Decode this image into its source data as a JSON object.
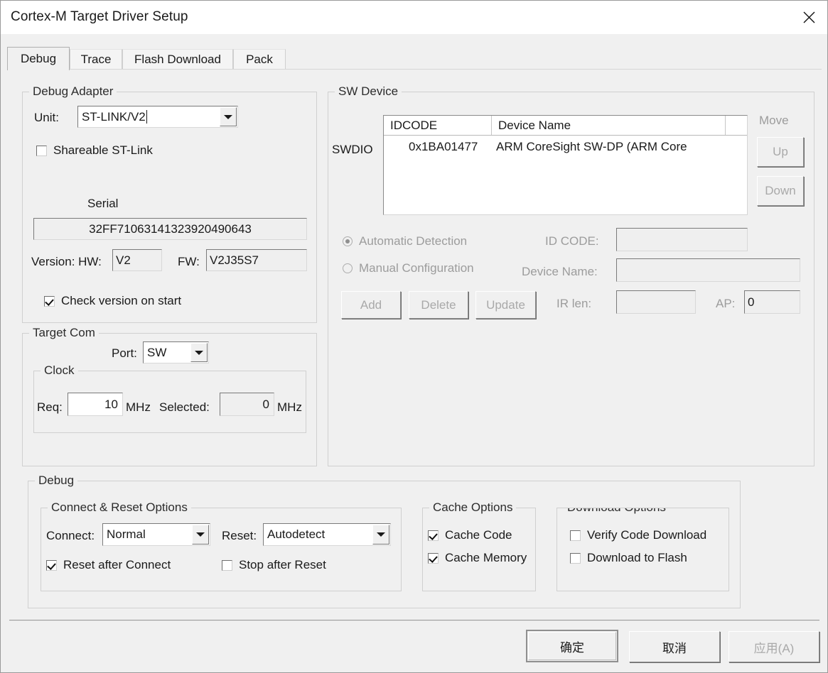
{
  "window": {
    "title": "Cortex-M Target Driver Setup",
    "close_icon": "close-icon"
  },
  "tabs": [
    {
      "label": "Debug",
      "active": true
    },
    {
      "label": "Trace",
      "active": false
    },
    {
      "label": "Flash Download",
      "active": false
    },
    {
      "label": "Pack",
      "active": false
    }
  ],
  "debug_adapter": {
    "legend": "Debug Adapter",
    "unit_label": "Unit:",
    "unit_value": "ST-LINK/V2",
    "shareable_label": "Shareable ST-Link",
    "shareable_checked": false,
    "serial_label": "Serial",
    "serial_value": "32FF71063141323920490643",
    "version_label": "Version: HW:",
    "hw_value": "V2",
    "fw_label": "FW:",
    "fw_value": "V2J35S7",
    "check_version_label": "Check version on start",
    "check_version_checked": true
  },
  "target_com": {
    "legend": "Target Com",
    "port_label": "Port:",
    "port_value": "SW",
    "clock": {
      "legend": "Clock",
      "req_label": "Req:",
      "req_value": "10",
      "req_unit": "MHz",
      "selected_label": "Selected:",
      "selected_value": "0",
      "selected_unit": "MHz"
    }
  },
  "sw_device": {
    "legend": "SW Device",
    "swdio_label": "SWDIO",
    "columns": [
      "IDCODE",
      "Device Name",
      ""
    ],
    "rows": [
      {
        "idcode": "0x1BA01477",
        "device_name": "ARM CoreSight SW-DP (ARM Core"
      }
    ],
    "move_label": "Move",
    "up_label": "Up",
    "down_label": "Down",
    "automatic_detection_label": "Automatic Detection",
    "automatic_detection_selected": true,
    "manual_configuration_label": "Manual Configuration",
    "manual_configuration_selected": false,
    "id_code_label": "ID CODE:",
    "id_code_value": "",
    "device_name_label": "Device Name:",
    "device_name_value": "",
    "ir_len_label": "IR len:",
    "ir_len_value": "",
    "ap_label": "AP:",
    "ap_value": "0",
    "add_label": "Add",
    "delete_label": "Delete",
    "update_label": "Update"
  },
  "debug_section": {
    "legend": "Debug",
    "connect_reset": {
      "legend": "Connect & Reset Options",
      "connect_label": "Connect:",
      "connect_value": "Normal",
      "reset_label": "Reset:",
      "reset_value": "Autodetect",
      "reset_after_connect_label": "Reset after Connect",
      "reset_after_connect_checked": true,
      "stop_after_reset_label": "Stop after Reset",
      "stop_after_reset_checked": false
    },
    "cache": {
      "legend": "Cache Options",
      "cache_code_label": "Cache Code",
      "cache_code_checked": true,
      "cache_memory_label": "Cache Memory",
      "cache_memory_checked": true
    },
    "download": {
      "legend": "Download Options",
      "verify_code_download_label": "Verify Code Download",
      "verify_code_download_checked": false,
      "download_to_flash_label": "Download to Flash",
      "download_to_flash_checked": false
    }
  },
  "footer": {
    "ok_label": "确定",
    "cancel_label": "取消",
    "apply_label": "应用(A)"
  }
}
